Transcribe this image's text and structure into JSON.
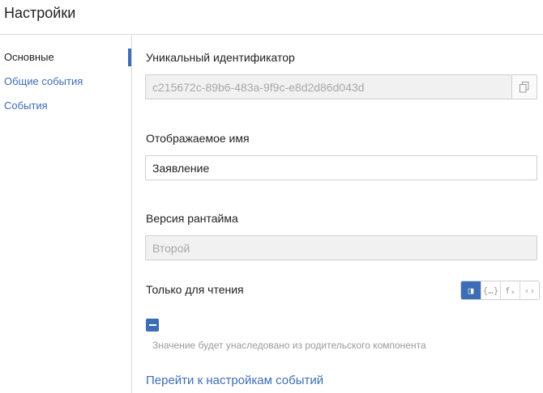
{
  "header": {
    "title": "Настройки"
  },
  "sidebar": {
    "items": [
      {
        "label": "Основные"
      },
      {
        "label": "Общие события"
      },
      {
        "label": "События"
      }
    ]
  },
  "form": {
    "uid": {
      "label": "Уникальный идентификатор",
      "value": "c215672c-89b6-483a-9f9c-e8d2d86d043d",
      "copy_icon": "copy-icon"
    },
    "display_name": {
      "label": "Отображаемое имя",
      "value": "Заявление"
    },
    "runtime_version": {
      "label": "Версия рантайма",
      "value": "Второй"
    },
    "read_only": {
      "label": "Только для чтения",
      "modes": [
        {
          "icon": "checkbox-mode-icon",
          "glyph": "◨",
          "active": true
        },
        {
          "icon": "binding-icon",
          "glyph": "{…}",
          "active": false
        },
        {
          "icon": "formula-icon",
          "glyph": "fₓ",
          "active": false
        },
        {
          "icon": "code-icon",
          "glyph": "‹›",
          "active": false
        }
      ],
      "hint": "Значение будет унаследовано из родительского компонента"
    },
    "events_link": "Перейти к настройкам событий"
  },
  "colors": {
    "accent": "#3d6db5",
    "border": "#cfcfcf",
    "disabled_bg": "#f1f1f1"
  }
}
